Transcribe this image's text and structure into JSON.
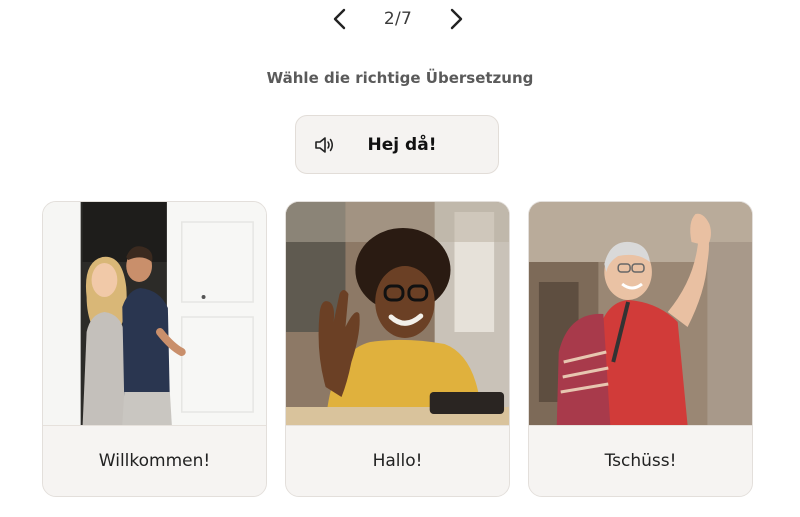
{
  "pager": {
    "current": "2/7",
    "prev_icon": "chevron-left-icon",
    "next_icon": "chevron-right-icon"
  },
  "instruction": "Wähle die richtige Übersetzung",
  "prompt": {
    "word": "Hej då!",
    "icon": "speaker-icon"
  },
  "options": [
    {
      "label": "Willkommen!",
      "image": "couple-at-door"
    },
    {
      "label": "Hallo!",
      "image": "man-waving-at-phone"
    },
    {
      "label": "Tschüss!",
      "image": "traveler-waving-goodbye"
    }
  ]
}
